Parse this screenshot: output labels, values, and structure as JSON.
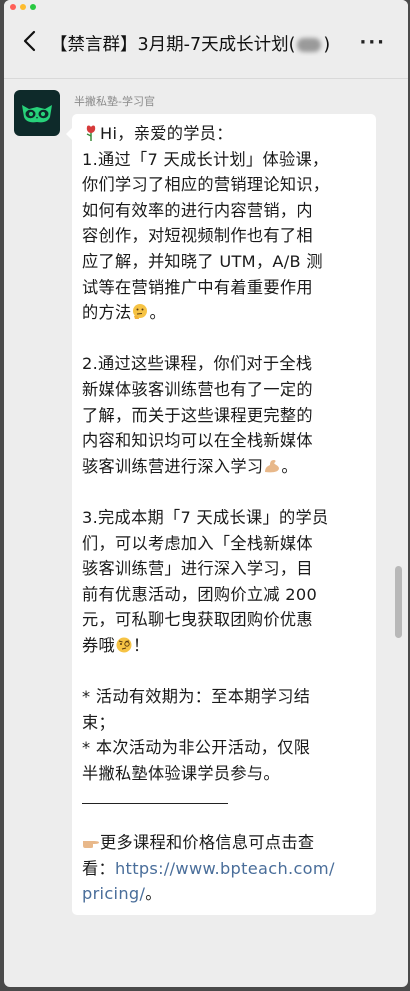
{
  "window": {
    "title": "【禁言群】3月期-7天成长计划(",
    "title_end": ")",
    "more_icon": "···"
  },
  "message": {
    "sender": "半撇私塾-学习官",
    "lines": [
      "Hi，亲爱的学员：",
      "1.通过「7 天成长计划」体验课，",
      "你们学习了相应的营销理论知识，",
      "如何有效率的进行内容营销，内",
      "容创作，对短视频制作也有了相",
      "应了解，并知晓了 UTM，A/B 测",
      "试等在营销推广中有着重要作用",
      "的方法",
      "2.通过这些课程，你们对于全栈",
      "新媒体骇客训练营也有了一定的",
      "了解，而关于这些课程更完整的",
      "内容和知识均可以在全栈新媒体",
      "骇客训练营进行深入学习",
      "3.完成本期「7 天成长课」的学员",
      "们，可以考虑加入「全栈新媒体",
      "骇客训练营」进行深入学习，目",
      "前有优惠活动，团购价立减 200",
      "元，可私聊七曳获取团购价优惠",
      "券哦",
      "* 活动有效期为：至本期学习结",
      "束；",
      "* 本次活动为非公开活动，仅限",
      "半撇私塾体验课学员参与。",
      "更多课程和价格信息可点击查",
      "看：",
      "https://www.bpteach.com/",
      "pricing/",
      "。"
    ],
    "punct_period": "。",
    "punct_bang": "！"
  },
  "icons": {
    "back": "chevron-left-icon",
    "rose": "rose-icon",
    "thinking": "thinking-face-icon",
    "muscle": "flexed-biceps-icon",
    "raised_brow": "face-with-monocle-icon",
    "pointing": "pointing-right-icon",
    "owl_logo": "owl-logo-icon"
  }
}
